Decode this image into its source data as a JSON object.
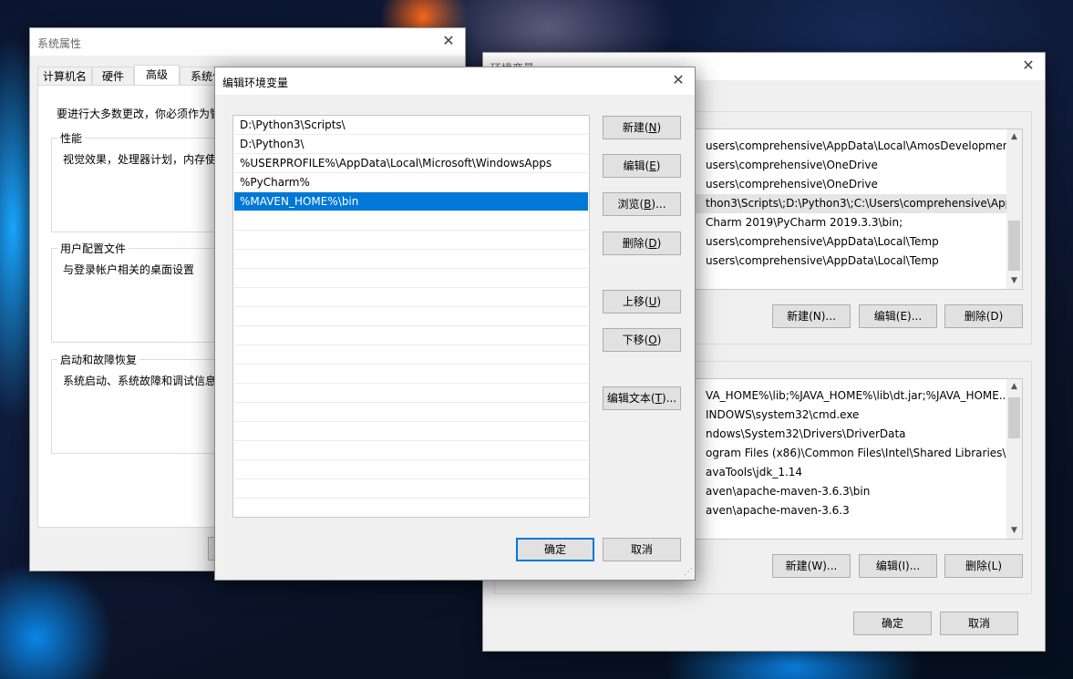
{
  "sysprop": {
    "title": "系统属性",
    "tabs": [
      "计算机名",
      "硬件",
      "高级",
      "系统保"
    ],
    "intro": "要进行大多数更改，你必须作为管",
    "groups": [
      {
        "title": "性能",
        "text": "视觉效果，处理器计划，内存使"
      },
      {
        "title": "用户配置文件",
        "text": "与登录帐户相关的桌面设置"
      },
      {
        "title": "启动和故障恢复",
        "text": "系统启动、系统故障和调试信息"
      }
    ]
  },
  "envvars": {
    "title": "环境变量",
    "user_vars": [
      "users\\comprehensive\\AppData\\Local\\AmosDevelopment\\...",
      "users\\comprehensive\\OneDrive",
      "users\\comprehensive\\OneDrive",
      "thon3\\Scripts\\;D:\\Python3\\;C:\\Users\\comprehensive\\App...",
      "Charm 2019\\PyCharm 2019.3.3\\bin;",
      "users\\comprehensive\\AppData\\Local\\Temp",
      "users\\comprehensive\\AppData\\Local\\Temp"
    ],
    "user_buttons": {
      "new": "新建(N)...",
      "edit": "编辑(E)...",
      "delete": "删除(D)"
    },
    "sys_vars": [
      "VA_HOME%\\lib;%JAVA_HOME%\\lib\\dt.jar;%JAVA_HOME...",
      "INDOWS\\system32\\cmd.exe",
      "ndows\\System32\\Drivers\\DriverData",
      "ogram Files (x86)\\Common Files\\Intel\\Shared Libraries\\",
      "avaTools\\jdk_1.14",
      "aven\\apache-maven-3.6.3\\bin",
      "aven\\apache-maven-3.6.3"
    ],
    "sys_buttons": {
      "new": "新建(W)...",
      "edit": "编辑(I)...",
      "delete": "删除(L)"
    },
    "ok": "确定",
    "cancel": "取消"
  },
  "editenv": {
    "title": "编辑环境变量",
    "paths": [
      "D:\\Python3\\Scripts\\",
      "D:\\Python3\\",
      "%USERPROFILE%\\AppData\\Local\\Microsoft\\WindowsApps",
      "%PyCharm%",
      "%MAVEN_HOME%\\bin"
    ],
    "selected_index": 4,
    "buttons": {
      "new_label": "新建",
      "new_key": "N",
      "edit_label": "编辑",
      "edit_key": "E",
      "browse_label": "浏览",
      "browse_key": "B",
      "browse_suffix": "...",
      "delete_label": "删除",
      "delete_key": "D",
      "up_label": "上移",
      "up_key": "U",
      "down_label": "下移",
      "down_key": "O",
      "edittext_label": "编辑文本",
      "edittext_key": "T",
      "edittext_suffix": "..."
    },
    "ok": "确定",
    "cancel": "取消"
  }
}
